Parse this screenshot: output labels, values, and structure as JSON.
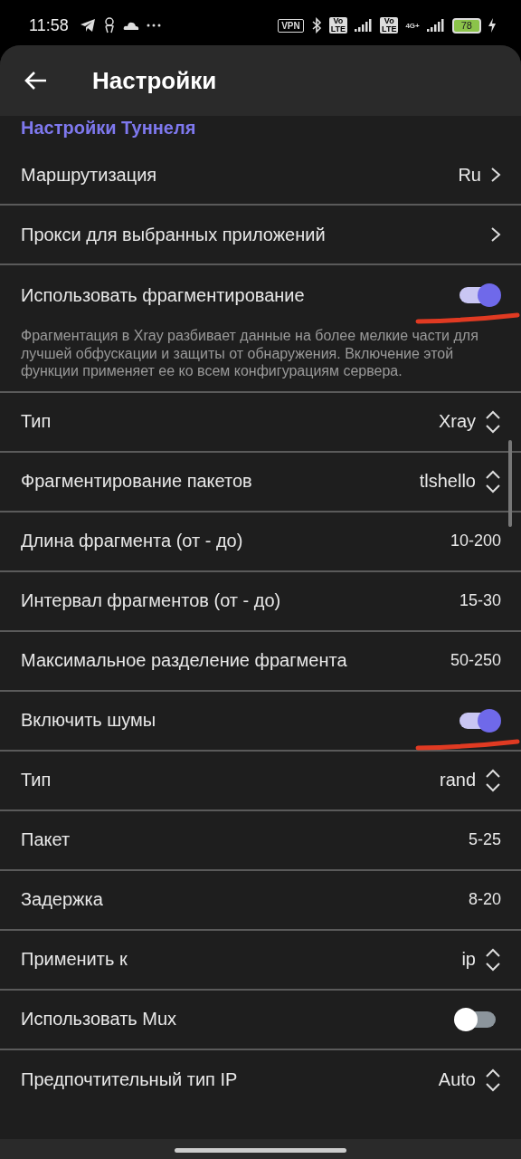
{
  "status_bar": {
    "time": "11:58",
    "vpn": "VPN",
    "volte": [
      {
        "top": "Vo",
        "bottom": "LTE"
      },
      {
        "top": "Vo",
        "bottom": "LTE"
      }
    ],
    "network": "4G+",
    "battery": "78"
  },
  "header": {
    "title": "Настройки"
  },
  "section": {
    "title": "Настройки Туннеля"
  },
  "items": [
    {
      "kind": "link",
      "label": "Маршрутизация",
      "value": "Ru"
    },
    {
      "kind": "link",
      "label": "Прокси для выбранных приложений"
    },
    {
      "kind": "toggle",
      "label": "Использовать фрагментирование",
      "on": true,
      "marked": true
    },
    {
      "kind": "description",
      "text": "Фрагментация в Xray разбивает данные на более мелкие части для лучшей обфускации и защиты от обнаружения. Включение этой функции применяет ее ко всем конфигурациям сервера."
    },
    {
      "kind": "select",
      "label": "Тип",
      "value": "Xray"
    },
    {
      "kind": "select",
      "label": "Фрагментирование пакетов",
      "value": "tlshello"
    },
    {
      "kind": "value",
      "label": "Длина фрагмента (от - до)",
      "value": "10-200"
    },
    {
      "kind": "value",
      "label": "Интервал фрагментов (от - до)",
      "value": "15-30"
    },
    {
      "kind": "value",
      "label": "Максимальное разделение фрагмента",
      "value": "50-250"
    },
    {
      "kind": "toggle",
      "label": "Включить шумы",
      "on": true,
      "marked": true
    },
    {
      "kind": "select",
      "label": "Тип",
      "value": "rand"
    },
    {
      "kind": "value",
      "label": "Пакет",
      "value": "5-25"
    },
    {
      "kind": "value",
      "label": "Задержка",
      "value": "8-20"
    },
    {
      "kind": "select",
      "label": "Применить к",
      "value": "ip"
    },
    {
      "kind": "toggle",
      "label": "Использовать Mux",
      "on": false,
      "marked": false
    },
    {
      "kind": "select",
      "label": "Предпочтительный тип IP",
      "value": "Auto"
    }
  ]
}
